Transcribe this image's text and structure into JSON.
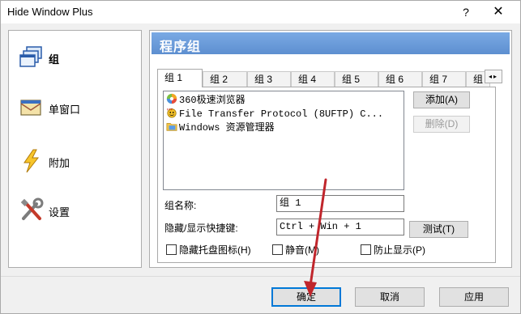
{
  "window": {
    "title": "Hide Window Plus",
    "help_glyph": "?",
    "close_glyph": "✕"
  },
  "sidebar": {
    "items": [
      {
        "label": "组",
        "icon": "windows-stack-icon",
        "active": true
      },
      {
        "label": "单窗口",
        "icon": "envelope-window-icon",
        "active": false
      },
      {
        "label": "附加",
        "icon": "lightning-icon",
        "active": false
      },
      {
        "label": "设置",
        "icon": "tools-icon",
        "active": false
      }
    ]
  },
  "panel": {
    "title": "程序组",
    "tabs": [
      {
        "label": "组 1",
        "active": true
      },
      {
        "label": "组 2",
        "active": false
      },
      {
        "label": "组 3",
        "active": false
      },
      {
        "label": "组 4",
        "active": false
      },
      {
        "label": "组 5",
        "active": false
      },
      {
        "label": "组 6",
        "active": false
      },
      {
        "label": "组 7",
        "active": false
      },
      {
        "label": "组",
        "active": false
      }
    ],
    "tab_scroll": "◂▸",
    "programs": [
      {
        "label": "360极速浏览器",
        "icon": "browser-360-icon"
      },
      {
        "label": "File Transfer Protocol (8UFTP) C...",
        "icon": "ftp-icon"
      },
      {
        "label": "Windows 资源管理器",
        "icon": "folder-icon"
      }
    ],
    "add_button": "添加(A)",
    "delete_button": "删除(D)",
    "group_name_label": "组名称:",
    "group_name_value": "组 1",
    "hotkey_label": "隐藏/显示快捷键:",
    "hotkey_value": "Ctrl + Win + 1",
    "test_button": "测试(T)",
    "checkboxes": [
      {
        "label": "隐藏托盘图标(H)",
        "checked": false
      },
      {
        "label": "静音(M)",
        "checked": false
      },
      {
        "label": "防止显示(P)",
        "checked": false
      }
    ]
  },
  "footer": {
    "ok_button": "确定",
    "cancel_button": "取消",
    "apply_button": "应用"
  },
  "colors": {
    "panel_header": "#6a9bd8",
    "annotation_arrow": "#c0262c",
    "focus_border": "#0078d7"
  }
}
